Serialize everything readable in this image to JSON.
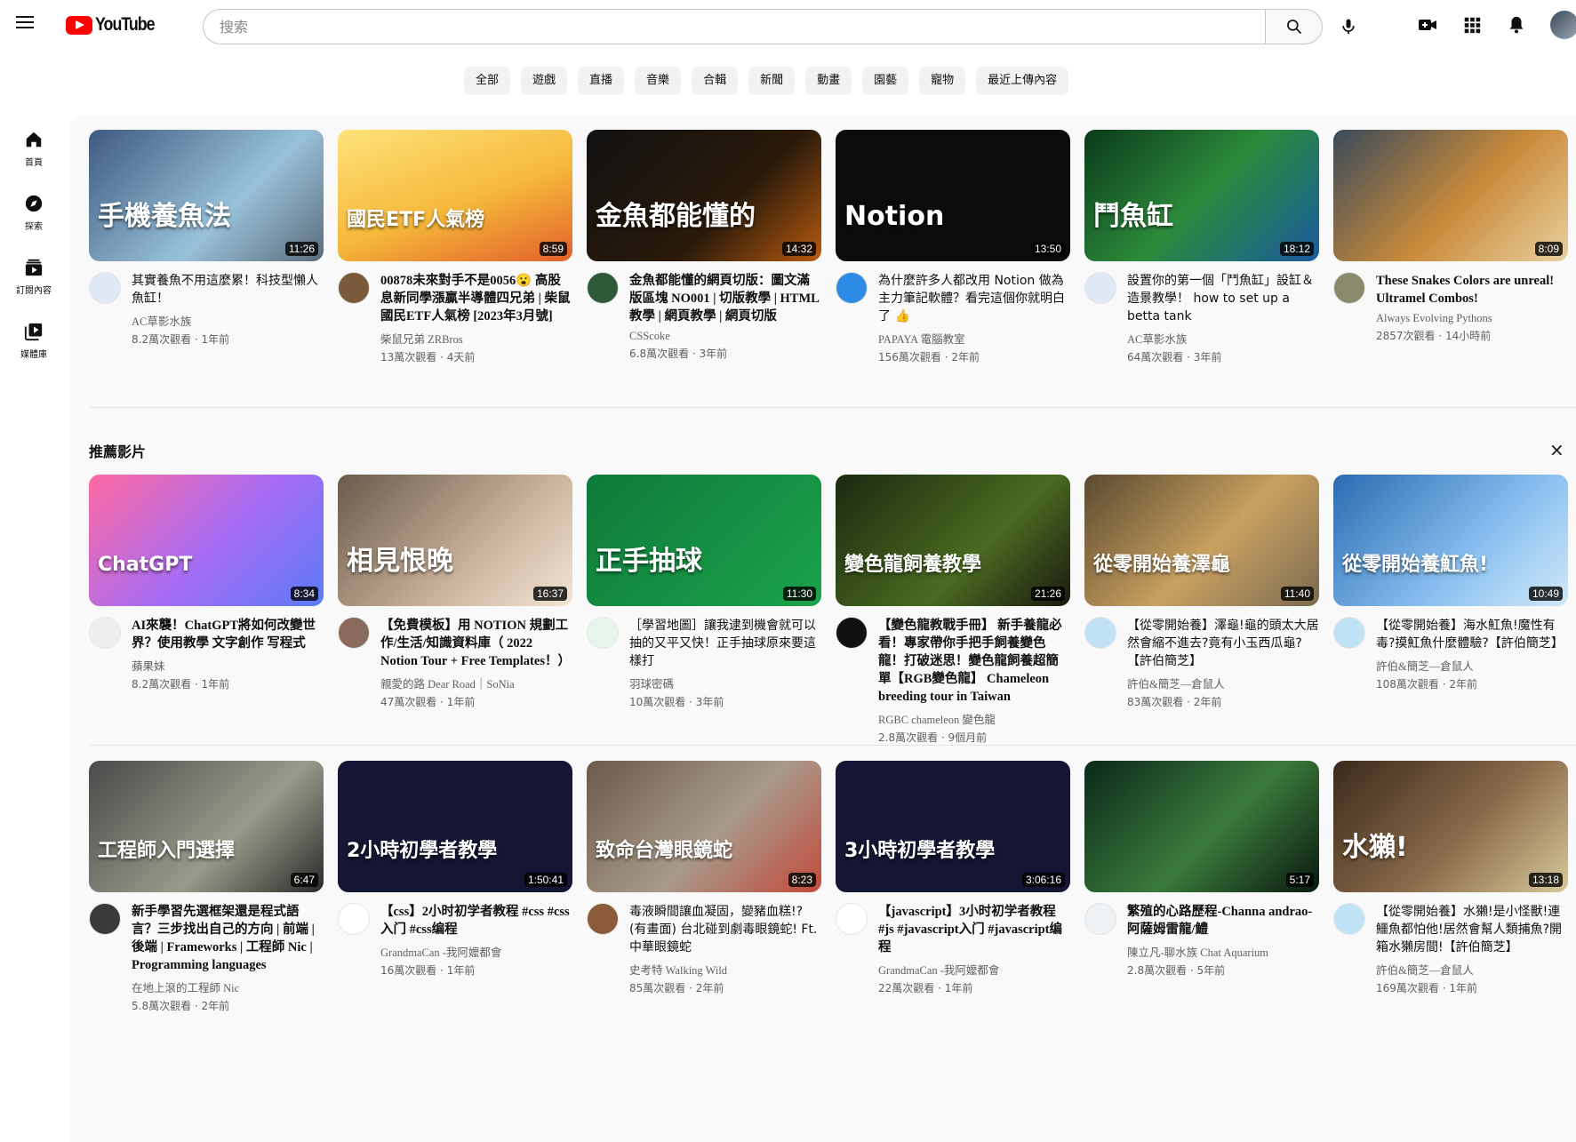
{
  "app": {
    "logo_text": "YouTube"
  },
  "search": {
    "placeholder": "搜索"
  },
  "chips": [
    "全部",
    "遊戲",
    "直播",
    "音樂",
    "合輯",
    "新聞",
    "動畫",
    "園藝",
    "寵物",
    "最近上傳內容"
  ],
  "sidebar": [
    {
      "label": "首頁",
      "icon": "home-icon"
    },
    {
      "label": "探索",
      "icon": "compass-icon"
    },
    {
      "label": "訂閱內容",
      "icon": "subscriptions-icon"
    },
    {
      "label": "媒體庫",
      "icon": "library-icon"
    }
  ],
  "section": {
    "title": "推薦影片",
    "close": "×"
  },
  "rows": [
    [
      {
        "title": "其實養魚不用這麼累！科技型懶人魚缸！",
        "channel": "AC草影水族",
        "stats": "8.2萬次觀看 · 1年前",
        "duration": "11:26",
        "thumb_text": "手機養魚法",
        "thumb_bg": "linear-gradient(135deg,#3d5a80,#98c1d9 60%,#5b6c7b)",
        "avatar_bg": "#dfe9f5",
        "sans": true
      },
      {
        "title": "00878未來對手不是0056😮 高股息新同學漲贏半導體四兄弟 | 柴鼠國民ETF人氣榜 [2023年3月號]",
        "channel": "柴鼠兄弟 ZRBros",
        "stats": "13萬次觀看 · 4天前",
        "duration": "8:59",
        "thumb_text": "國民ETF人氣榜",
        "thumb_bg": "linear-gradient(160deg,#ffe27a,#f5b83a 55%,#e2602b)",
        "avatar_bg": "#7a5a3a",
        "sans": false
      },
      {
        "title": "金魚都能懂的網頁切版：圖文滿版區塊 NO001 | 切版教學 | HTML教學 | 網頁教學 | 網頁切版",
        "channel": "CSScoke",
        "stats": "6.8萬次觀看 · 3年前",
        "duration": "14:32",
        "thumb_text": "金魚都能懂的",
        "thumb_bg": "linear-gradient(135deg,#111,#2a1a0a 60%,#b85a10)",
        "avatar_bg": "#2f5a3a",
        "sans": false
      },
      {
        "title": "為什麼許多人都改用 Notion 做為主力筆記軟體？看完這個你就明白了 👍",
        "channel": "PAPAYA 電腦教室",
        "stats": "156萬次觀看 · 2年前",
        "duration": "13:50",
        "thumb_text": "Notion",
        "thumb_bg": "#0b0b0b",
        "avatar_bg": "#2d8be6",
        "sans": true
      },
      {
        "title": "設置你的第一個「鬥魚缸」設缸＆造景教學！ how to set up a betta tank",
        "channel": "AC草影水族",
        "stats": "64萬次觀看 · 3年前",
        "duration": "18:12",
        "thumb_text": "鬥魚缸",
        "thumb_bg": "linear-gradient(135deg,#0a3a1a,#2c8a3a 50%,#1a5aa0)",
        "avatar_bg": "#dfe9f5",
        "sans": true
      },
      {
        "title": "These Snakes Colors are unreal! Ultramel Combos!",
        "channel": "Always Evolving Pythons",
        "stats": "2857次觀看 · 14小時前",
        "duration": "8:09",
        "thumb_text": "",
        "thumb_bg": "linear-gradient(135deg,#3a4a5a,#c98a3a 55%,#e9d0a0)",
        "avatar_bg": "#8a8a6a",
        "sans": false
      }
    ],
    [
      {
        "title": "AI來襲！ChatGPT將如何改變世界？使用教學 文字創作 写程式",
        "channel": "蘋果妹",
        "stats": "8.2萬次觀看 · 1年前",
        "duration": "8:34",
        "thumb_text": "ChatGPT",
        "thumb_bg": "linear-gradient(135deg,#ff6aa2,#a46cf5 55%,#5a7bf5)",
        "avatar_bg": "#eeeeee",
        "sans": false
      },
      {
        "title": "【免費模板】用 NOTION 規劃工作/生活/知識資料庫（ 2022 Notion Tour + Free Templates！）",
        "channel": "親愛的路 Dear Road｜SoNia",
        "stats": "47萬次觀看 · 1年前",
        "duration": "16:37",
        "thumb_text": "相見恨晚",
        "thumb_bg": "linear-gradient(135deg,#6a5a4a,#c9b29a 60%,#f2e4d4)",
        "avatar_bg": "#8a6a5a",
        "sans": false
      },
      {
        "title": "［學習地圖］讓我逮到機會就可以抽的又平又快！正手抽球原來要這樣打",
        "channel": "羽球密碼",
        "stats": "10萬次觀看 · 3年前",
        "duration": "11:30",
        "thumb_text": "正手抽球",
        "thumb_bg": "linear-gradient(135deg,#0f7a3a,#1aa34a)",
        "avatar_bg": "#e6f5ea",
        "sans": true
      },
      {
        "title": "【變色龍教戰手冊】 新手養龍必看！專家帶你手把手飼養變色龍！打破迷思！變色龍飼養超簡單【RGB變色龍】 Chameleon breeding tour in Taiwan",
        "channel": "RGBC chameleon 變色龍",
        "stats": "2.8萬次觀看 · 9個月前",
        "duration": "21:26",
        "thumb_text": "變色龍飼養教學",
        "thumb_bg": "linear-gradient(135deg,#1a2a10,#4a6a20 60%,#1a1a10)",
        "avatar_bg": "#111111",
        "sans": false
      },
      {
        "title": "【從零開始養】澤龜!龜的頭太大居然會縮不進去?竟有小玉西瓜龜?【許伯簡芝】",
        "channel": "許伯&簡芝—倉鼠人",
        "stats": "83萬次觀看 · 2年前",
        "duration": "11:40",
        "thumb_text": "從零開始養澤龜",
        "thumb_bg": "linear-gradient(135deg,#5a4a30,#c9a060 55%,#7a6a50)",
        "avatar_bg": "#bfe3f5",
        "sans": true
      },
      {
        "title": "【從零開始養】海水魟魚!魔性有毒?摸魟魚什麼體驗?【許伯簡芝】",
        "channel": "許伯&簡芝—倉鼠人",
        "stats": "108萬次觀看 · 2年前",
        "duration": "10:49",
        "thumb_text": "從零開始養魟魚!",
        "thumb_bg": "linear-gradient(135deg,#2a6ab0,#8ac0f0 60%,#d0e8f8)",
        "avatar_bg": "#bfe3f5",
        "sans": true
      }
    ],
    [
      {
        "title": "新手學習先選框架還是程式語言？三步找出自己的方向 | 前端 | 後端 | Frameworks | 工程師 Nic | Programming languages",
        "channel": "在地上滾的工程師 Nic",
        "stats": "5.8萬次觀看 · 2年前",
        "duration": "6:47",
        "thumb_text": "工程師入門選擇",
        "thumb_bg": "linear-gradient(135deg,#4a4a4a,#9a9a8a 60%,#2a2a2a)",
        "avatar_bg": "#3a3a3a",
        "sans": false
      },
      {
        "title": "【css】2小时初学者教程 #css #css入门 #css编程",
        "channel": "GrandmaCan -我阿嬤都會",
        "stats": "16萬次觀看 · 1年前",
        "duration": "1:50:41",
        "thumb_text": "2小時初學者教學",
        "thumb_bg": "#141633",
        "avatar_bg": "#ffffff",
        "sans": false
      },
      {
        "title": "毒液瞬間讓血凝固，變豬血糕!? (有畫面) 台北碰到劇毒眼鏡蛇! Ft. 中華眼鏡蛇",
        "channel": "史考特 Walking Wild",
        "stats": "85萬次觀看 · 2年前",
        "duration": "8:23",
        "thumb_text": "致命台灣眼鏡蛇",
        "thumb_bg": "linear-gradient(135deg,#6a5a4a,#a89a8a 55%,#c24a3a)",
        "avatar_bg": "#8a5a3a",
        "sans": true
      },
      {
        "title": "【javascript】3小时初学者教程 #js #javascript入门 #javascript编程",
        "channel": "GrandmaCan -我阿嬤都會",
        "stats": "22萬次觀看 · 1年前",
        "duration": "3:06:16",
        "thumb_text": "3小時初學者教學",
        "thumb_bg": "#141633",
        "avatar_bg": "#ffffff",
        "sans": false
      },
      {
        "title": "繁殖的心路歷程-Channa andrao-阿薩姆雷龍/鱧",
        "channel": "陳立凡-聊水族 Chat Aquarium",
        "stats": "2.8萬次觀看 · 5年前",
        "duration": "5:17",
        "thumb_text": "",
        "thumb_bg": "linear-gradient(135deg,#0a2a1a,#3a7a3a 55%,#0a1a10)",
        "avatar_bg": "#eef2f5",
        "sans": false
      },
      {
        "title": "【從零開始養】水獺!是小怪獸!連鱷魚都怕他!居然會幫人類捕魚?開箱水獺房間!【許伯簡芝】",
        "channel": "許伯&簡芝—倉鼠人",
        "stats": "169萬次觀看 · 1年前",
        "duration": "13:18",
        "thumb_text": "水獺!",
        "thumb_bg": "linear-gradient(135deg,#3a2a1a,#8a6a4a 55%,#d8c89a)",
        "avatar_bg": "#bfe3f5",
        "sans": true
      }
    ]
  ]
}
